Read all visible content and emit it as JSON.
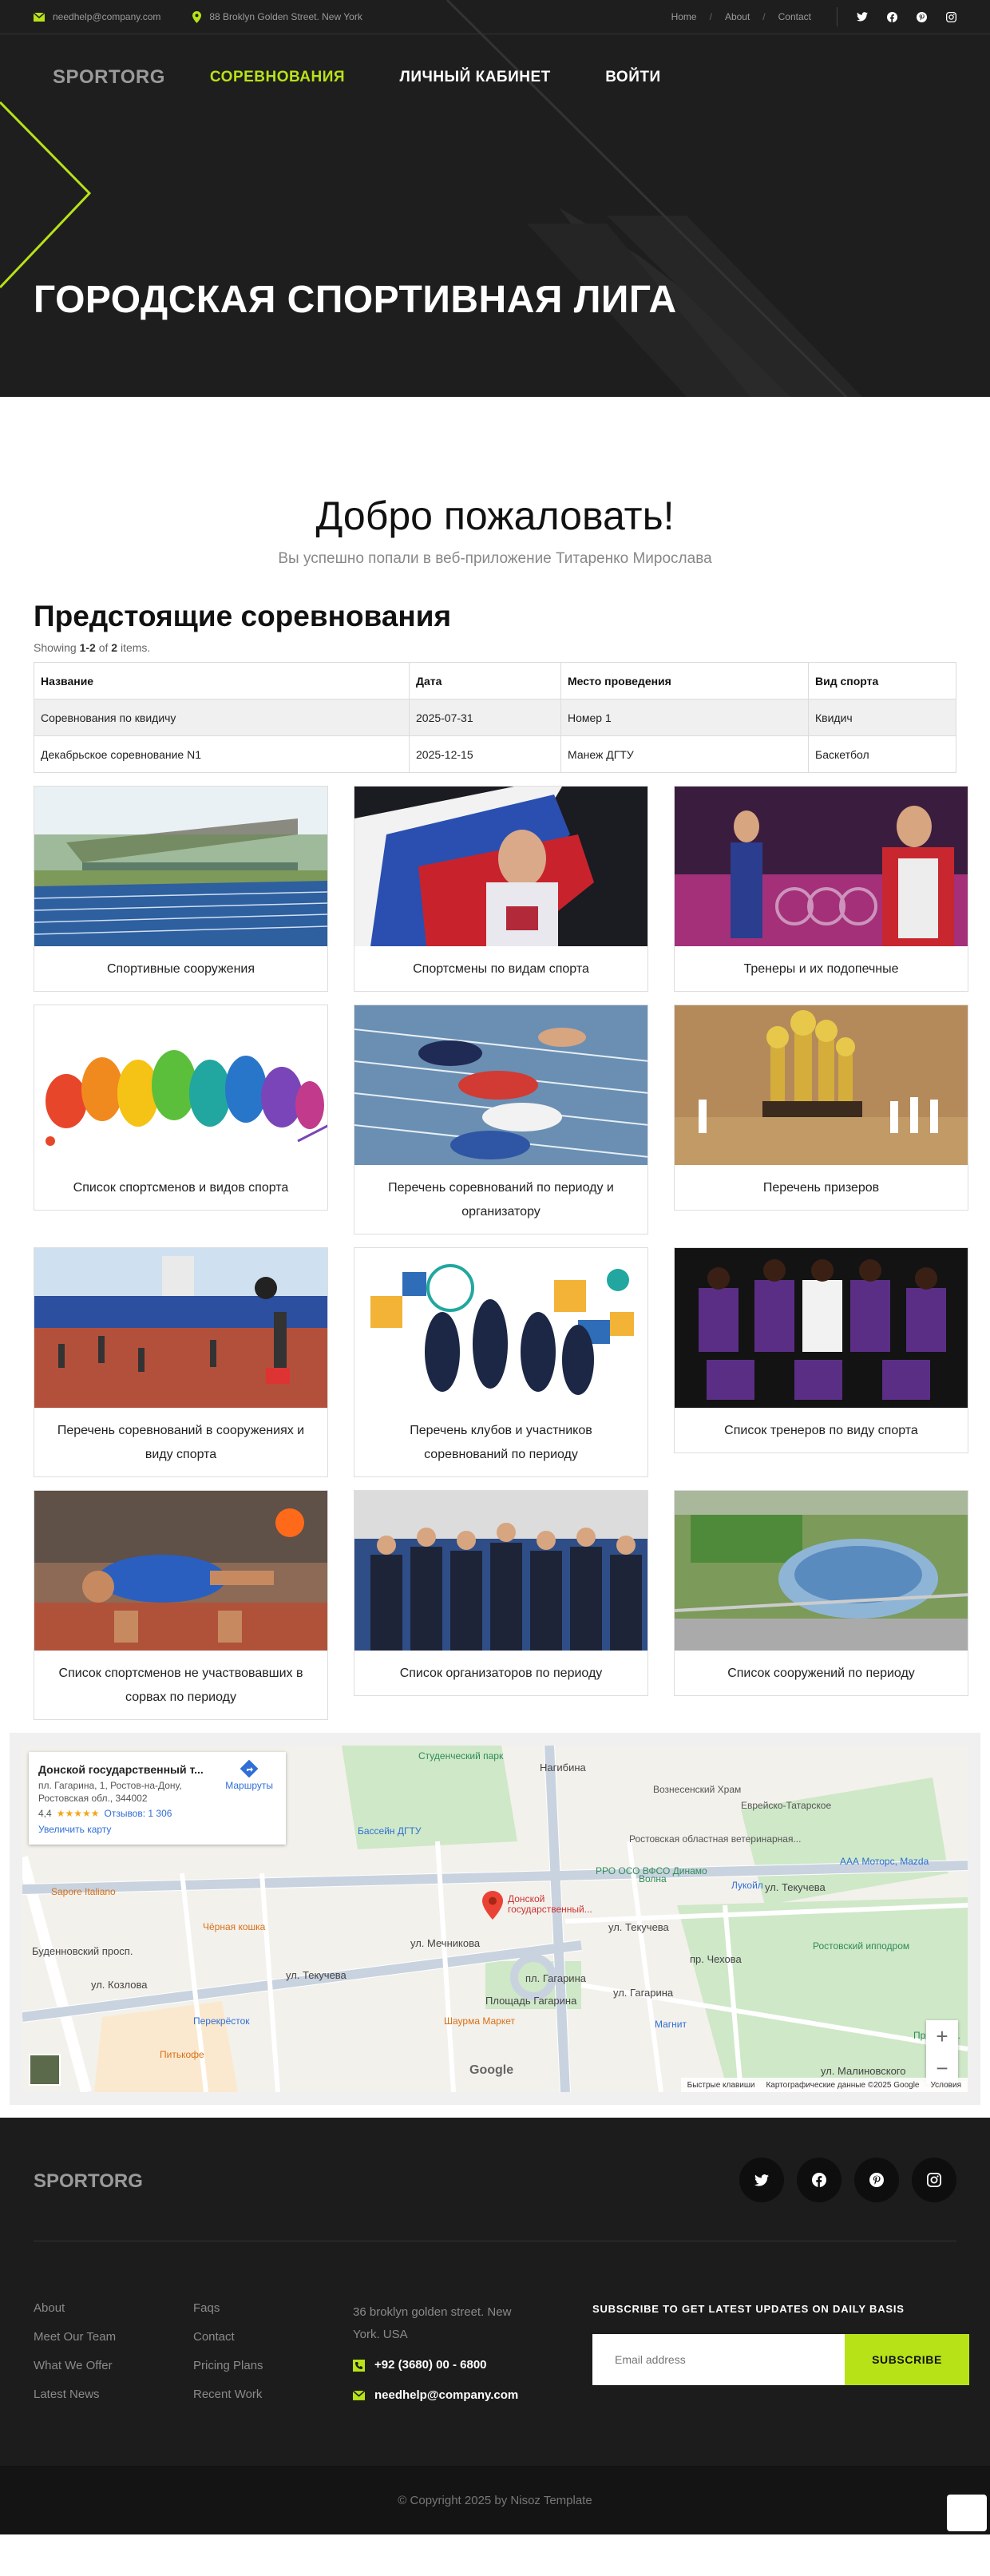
{
  "topbar": {
    "email": "needhelp@company.com",
    "address": "88 Broklyn Golden Street. New York",
    "links": [
      "Home",
      "About",
      "Contact"
    ]
  },
  "header": {
    "logo": "SPORTORG",
    "nav": [
      "СОРЕВНОВАНИЯ",
      "ЛИЧНЫЙ КАБИНЕТ",
      "ВОЙТИ"
    ],
    "hero_title": "ГОРОДСКАЯ СПОРТИВНАЯ ЛИГА"
  },
  "welcome": {
    "title": "Добро пожаловать!",
    "subtitle": "Вы успешно попали в веб-приложение Титаренко Мирослава"
  },
  "competitions": {
    "heading": "Предстоящие соревнования",
    "summary_prefix": "Showing ",
    "summary_range": "1-2",
    "summary_mid": " of ",
    "summary_total": "2",
    "summary_suffix": " items.",
    "columns": [
      "Название",
      "Дата",
      "Место проведения",
      "Вид спорта"
    ],
    "rows": [
      [
        "Соревнования по квидичу",
        "2025-07-31",
        "Номер 1",
        "Квидич"
      ],
      [
        "Декабрьское соревнование N1",
        "2025-12-15",
        "Манеж ДГТУ",
        "Баскетбол"
      ]
    ]
  },
  "cards": [
    {
      "label": "Спортивные сооружения",
      "image": "stadium"
    },
    {
      "label": "Спортсмены по видам спорта",
      "image": "athlete-flag"
    },
    {
      "label": "Тренеры и их подопечные",
      "image": "coach-gymnast"
    },
    {
      "label": "Список спортсменов и видов спорта",
      "image": "sports-silhouettes"
    },
    {
      "label": "Перечень соревнований по периоду и организатору",
      "image": "sprint-start"
    },
    {
      "label": "Перечень призеров",
      "image": "trophies"
    },
    {
      "label": "Перечень соревнований в сооружениях и виду спорта",
      "image": "track-field"
    },
    {
      "label": "Перечень клубов и участников соревнований по периоду",
      "image": "sports-collage"
    },
    {
      "label": "Список тренеров по виду спорта",
      "image": "basketball-team"
    },
    {
      "label": "Список спортсменов не участвовавших в сорвах по периоду",
      "image": "runner-exhausted"
    },
    {
      "label": "Список организаторов по периоду",
      "image": "organizers-group"
    },
    {
      "label": "Список сооружений по периоду",
      "image": "arena-aerial"
    }
  ],
  "map": {
    "place_name": "Донской государственный т...",
    "place_address": "пл. Гагарина, 1, Ростов-на-Дону, Ростовская обл., 344002",
    "rating": "4,4",
    "stars": "★★★★★",
    "reviews": "Отзывов: 1 306",
    "enlarge": "Увеличить карту",
    "directions": "Маршруты",
    "labels": {
      "park": "Студенческий парк",
      "pool": "Бассейн ДГТУ",
      "temple": "Вознесенский Храм",
      "church": "Еврейско-Татарское",
      "vet": "Ростовская областная ветеринарная...",
      "rro": "РРО ОСО ВФСО Динамо",
      "volna": "Волна",
      "lukoil": "Лукойл",
      "aaa": "ААА Моторс, Mazda",
      "hippo": "Ростовский ипподром",
      "pin": "Донской государственный...",
      "sapore": "Sapore Italiano",
      "koshka": "Чёрная кошка",
      "perekrestok": "Перекрёсток",
      "shaurma": "Шаурма Маркет",
      "pitkofe": "Питькофе",
      "magnit": "Магнит",
      "pryatki": "Прятки в...",
      "st_tekucheva": "ул. Текучева",
      "st_tekucheva2": "ул. Текучева",
      "st_mechnikova": "ул. Мечникова",
      "st_gagarina": "пл. Гагарина",
      "st_gagarina2": "ул. Гагарина",
      "st_kozlova": "ул. Козлова",
      "st_malinovskogo": "ул. Малиновского",
      "st_nagibina": "Нагибина",
      "st_budennovsky": "Буденновский просп.",
      "st_chehova": "пр. Чехова",
      "ploshad": "Площадь Гагарина"
    },
    "attribution": [
      "Быстрые клавиши",
      "Картографические данные ©2025 Google",
      "Условия"
    ],
    "google": "Google"
  },
  "footer": {
    "logo": "SPORTORG",
    "col1": [
      "About",
      "Meet Our Team",
      "What We Offer",
      "Latest News"
    ],
    "col2": [
      "Faqs",
      "Contact",
      "Pricing Plans",
      "Recent Work"
    ],
    "address": "36 broklyn golden street. New York. USA",
    "phone": "+92 (3680) 00 - 6800",
    "email": "needhelp@company.com",
    "subscribe_label": "SUBSCRIBE TO GET LATEST UPDATES ON DAILY BASIS",
    "email_placeholder": "Email address",
    "subscribe_button": "SUBSCRIBE",
    "copyright": "© Copyright 2025 by Nisoz Template"
  },
  "colors": {
    "accent": "#b8e218",
    "dark": "#1e1e1e"
  }
}
